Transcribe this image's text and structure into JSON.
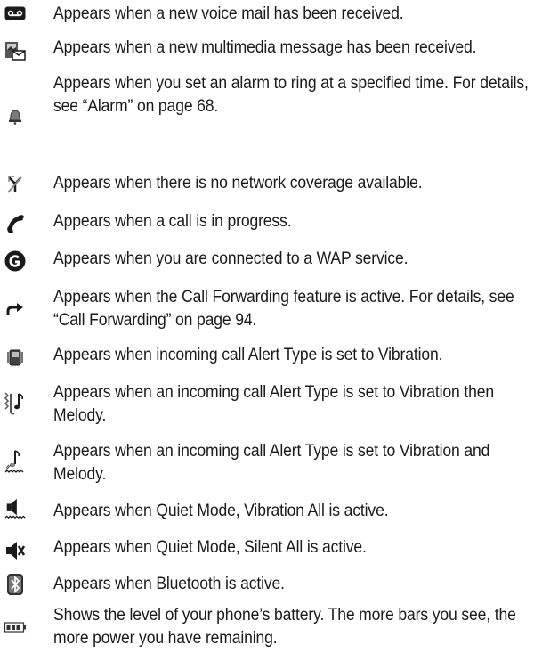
{
  "entries": [
    {
      "icon": "voicemail-icon",
      "text": "Appears when a new voice mail has been received."
    },
    {
      "icon": "multimedia-message-icon",
      "text": "Appears when a new multimedia message has been received."
    },
    {
      "icon": "alarm-bell-icon",
      "text": "Appears when you set an alarm to ring at a specified time. For details, see “Alarm” on page 68."
    },
    {
      "icon": "no-network-icon",
      "text": "Appears when there is no network coverage available."
    },
    {
      "icon": "call-in-progress-icon",
      "text": "Appears when a call is in progress."
    },
    {
      "icon": "wap-connected-icon",
      "text": "Appears when you are connected to a WAP service."
    },
    {
      "icon": "call-forwarding-icon",
      "text": "Appears when the Call Forwarding feature is active. For details, see “Call Forwarding” on page 94."
    },
    {
      "icon": "vibration-icon",
      "text": "Appears when incoming call Alert Type is set to Vibration."
    },
    {
      "icon": "vibration-then-melody-icon",
      "text": "Appears when an incoming call Alert Type is set to Vibration then Melody."
    },
    {
      "icon": "vibration-and-melody-icon",
      "text": "Appears when an incoming call Alert Type is set to Vibration and Melody."
    },
    {
      "icon": "quiet-mode-vibration-icon",
      "text": "Appears when Quiet Mode, Vibration All is active."
    },
    {
      "icon": "quiet-mode-silent-icon",
      "text": "Appears when Quiet Mode, Silent All is active."
    },
    {
      "icon": "bluetooth-icon",
      "text": "Appears when Bluetooth is active."
    },
    {
      "icon": "battery-icon",
      "text": "Shows the level of your phone’s battery. The more bars you see, the more power you have remaining."
    }
  ]
}
